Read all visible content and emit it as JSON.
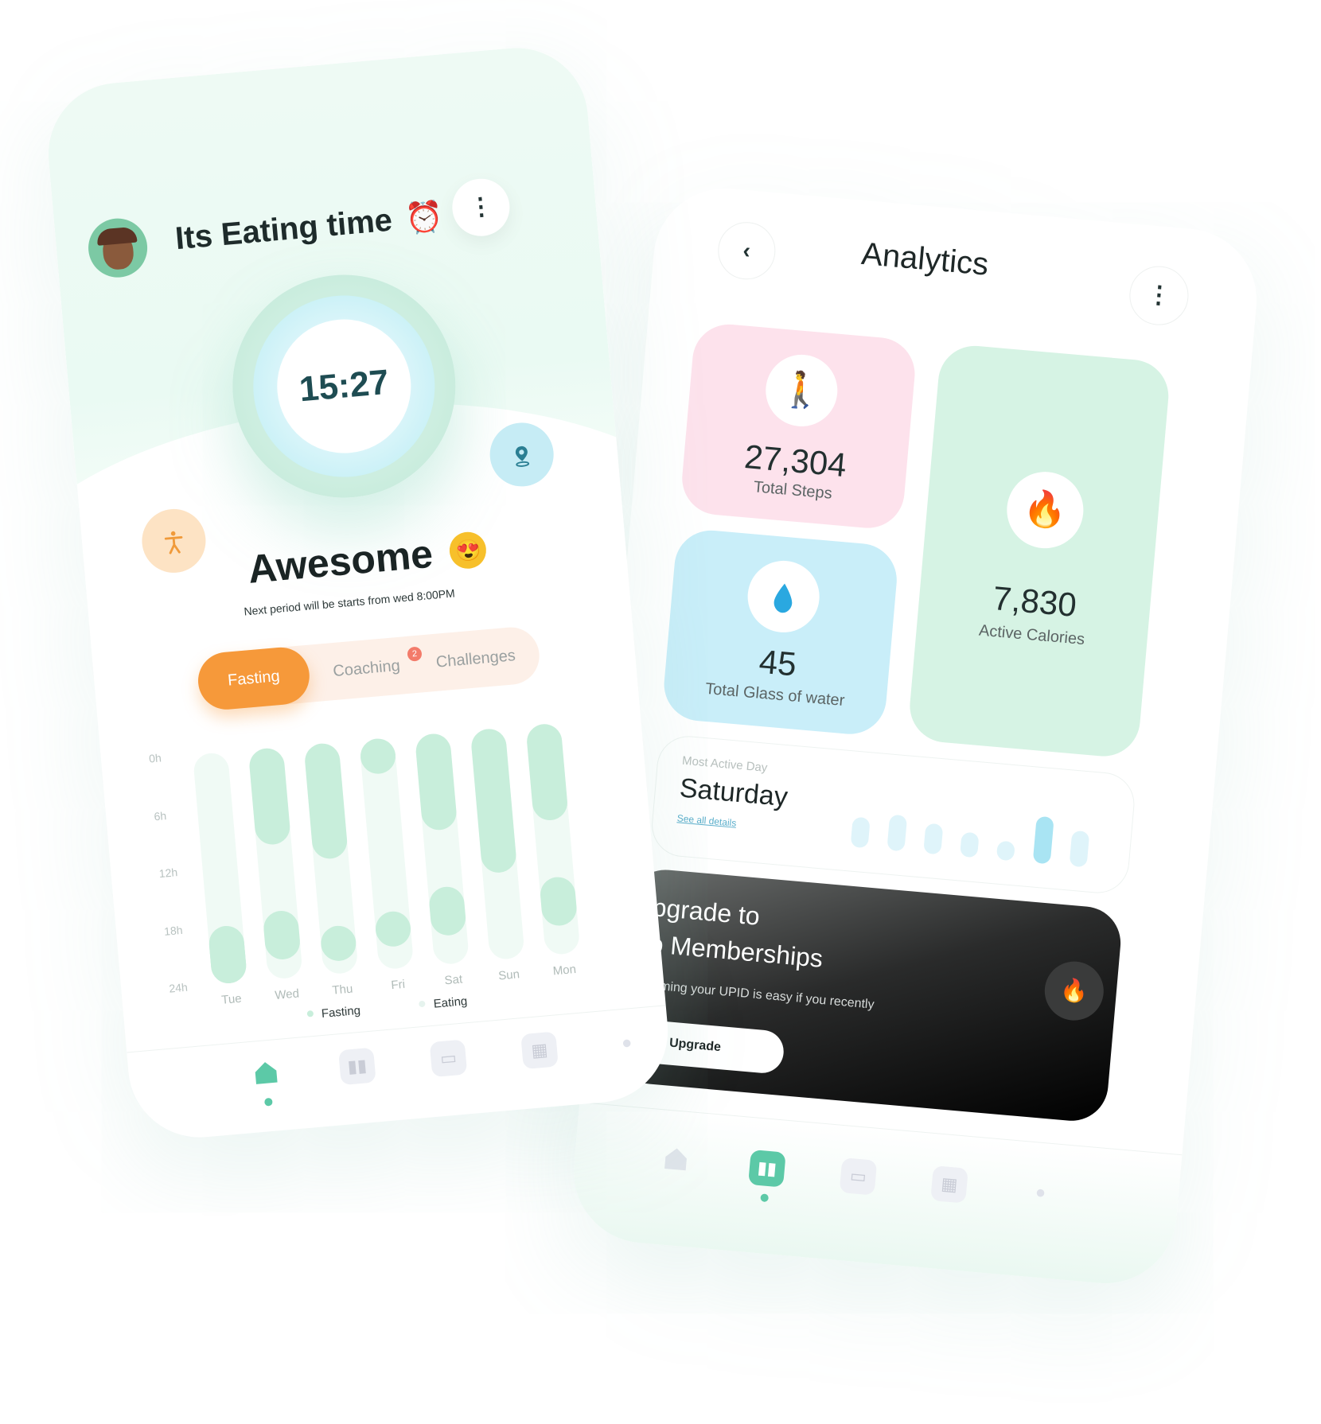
{
  "left_screen": {
    "greeting": "Its Eating time",
    "greeting_emoji": "⏰",
    "menu_icon": "⋮",
    "timer": "15:27",
    "status": "Awesome",
    "status_emoji": "😍",
    "next_period": "Next period will be starts from wed 8:00PM",
    "tabs": [
      {
        "label": "Fasting"
      },
      {
        "label": "Coaching",
        "badge": "2"
      },
      {
        "label": "Challenges"
      }
    ],
    "chart_data": {
      "type": "bar",
      "categories": [
        "Tue",
        "Wed",
        "Thu",
        "Fri",
        "Sat",
        "Sun",
        "Mon"
      ],
      "y_ticks": [
        "0h",
        "6h",
        "12h",
        "18h",
        "24h"
      ],
      "series": [
        {
          "name": "Fasting",
          "segments": [
            [
              18,
              24
            ],
            [
              0,
              10
            ],
            [
              0,
              12
            ],
            [
              0,
              3
            ],
            [
              0,
              10
            ],
            [
              0,
              15
            ],
            [
              0,
              10
            ]
          ]
        },
        {
          "name": "Eating",
          "segments": [
            [
              18,
              24
            ],
            [
              17,
              22
            ],
            [
              19,
              22
            ],
            [
              18,
              21
            ],
            [
              16,
              21
            ],
            [],
            [
              16,
              21
            ]
          ]
        }
      ],
      "legend": [
        "Fasting",
        "Eating"
      ],
      "colors": {
        "track": "#f0faf5",
        "fill": "#c8eedb",
        "fasting_dot": "#c8eedb",
        "eating_dot": "#f0faf5"
      }
    },
    "nav": [
      {
        "icon": "home-icon",
        "active": true
      },
      {
        "icon": "stats-icon"
      },
      {
        "icon": "card-icon"
      },
      {
        "icon": "calendar-icon"
      },
      {
        "icon": "profile-icon"
      }
    ]
  },
  "right_screen": {
    "back_icon": "‹",
    "title": "Analytics",
    "menu_icon": "⋮",
    "stats": {
      "steps": {
        "icon": "walking-icon",
        "value": "27,304",
        "label": "Total Steps"
      },
      "water": {
        "icon": "droplet-icon",
        "value": "45",
        "label": "Total Glass of water"
      },
      "calories": {
        "icon": "fire-icon",
        "value": "7,830",
        "label": "Active Calories"
      }
    },
    "active_day": {
      "label": "Most Active Day",
      "value": "Saturday",
      "link": "See all details",
      "bars": [
        0.55,
        0.65,
        0.55,
        0.45,
        0.35,
        0.85,
        0.65
      ],
      "highlight_index": 5
    },
    "upgrade": {
      "title_line1": "pgrade to",
      "title_line2": "o Memberships",
      "description": "eeming your UPID is easy if you recently",
      "button": "Upgrade"
    },
    "nav": [
      {
        "icon": "home-icon"
      },
      {
        "icon": "stats-icon",
        "active": true
      },
      {
        "icon": "card-icon"
      },
      {
        "icon": "calendar-icon"
      },
      {
        "icon": "profile-icon"
      }
    ]
  },
  "colors": {
    "accent_orange": "#f6993a",
    "accent_mint": "#5cc9a7",
    "badge_red": "#f37b6a"
  }
}
